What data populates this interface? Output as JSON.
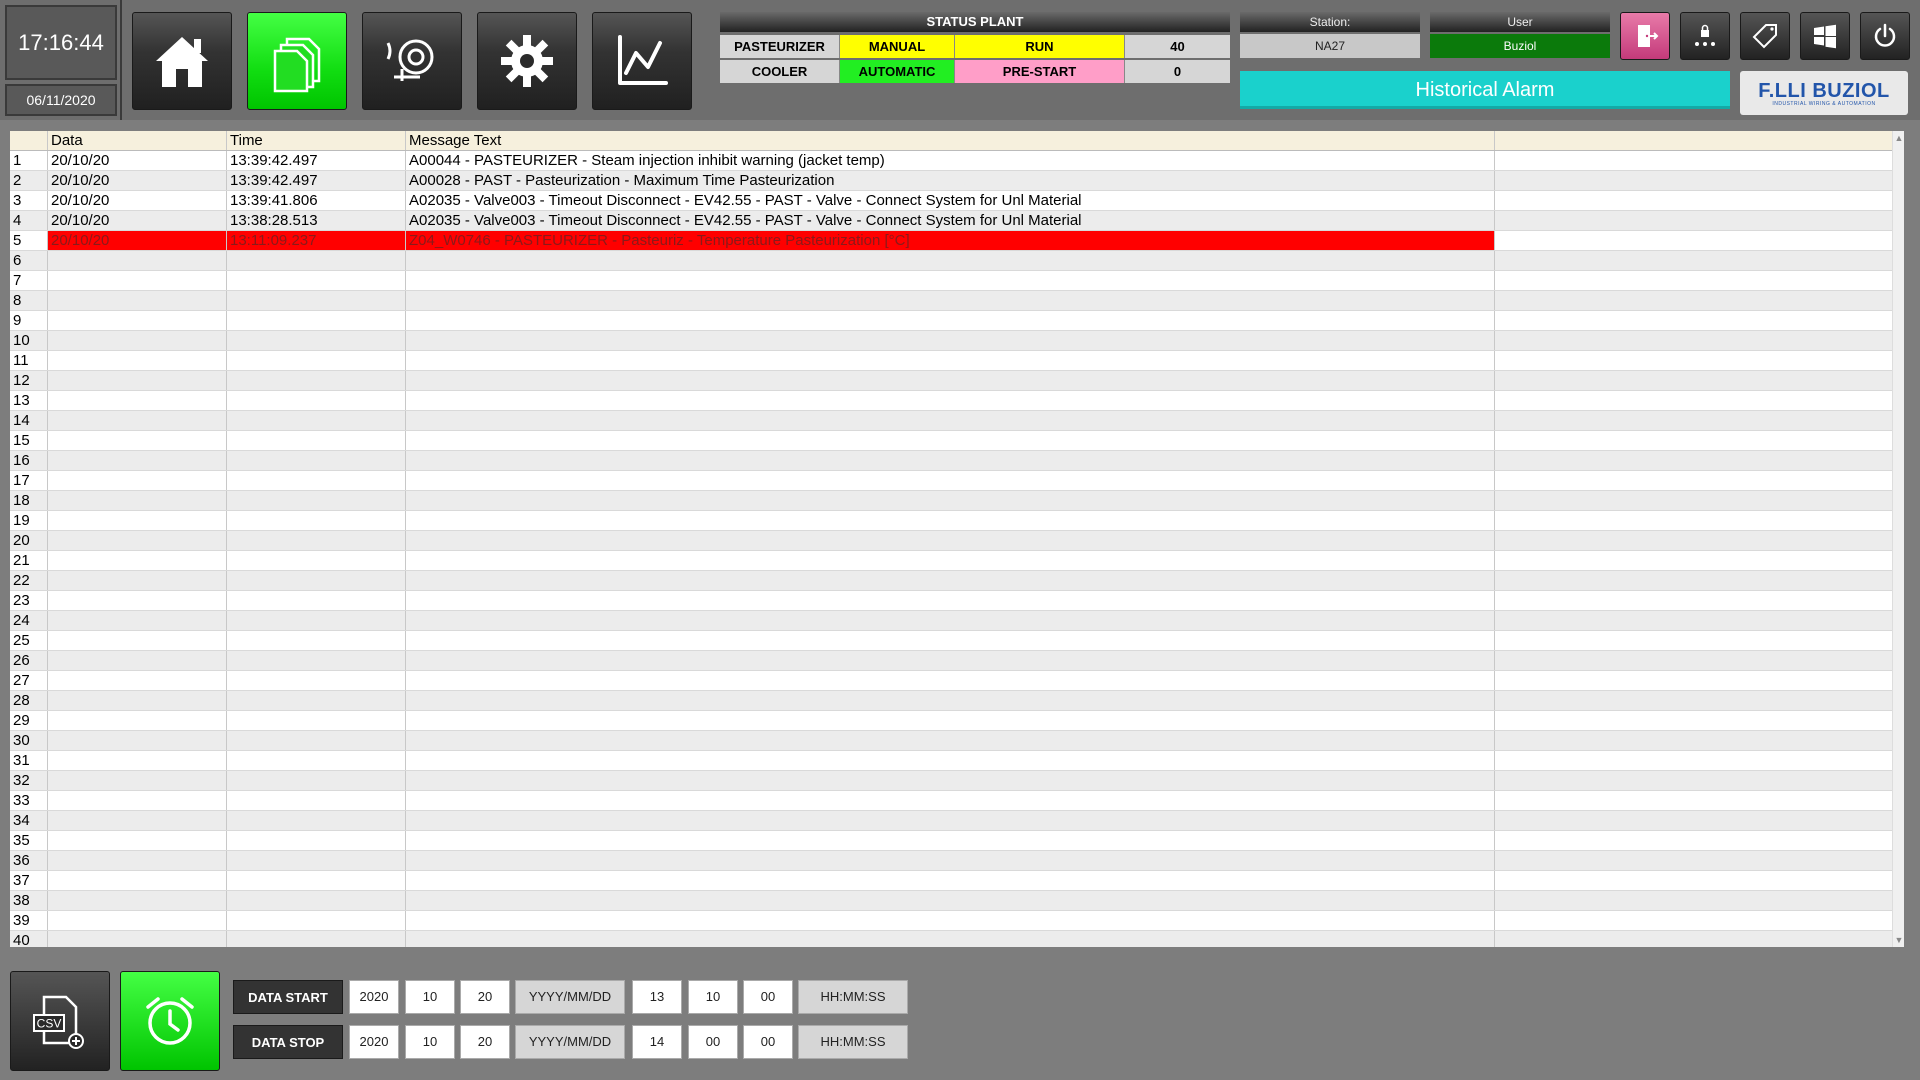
{
  "clock": {
    "time": "17:16:44",
    "date": "06/11/2020"
  },
  "nav": [
    {
      "id": "home",
      "icon": "home-icon",
      "active": false
    },
    {
      "id": "alarms-pages",
      "icon": "documents-icon",
      "active": true
    },
    {
      "id": "bell",
      "icon": "alarm-bell-icon",
      "active": false
    },
    {
      "id": "settings",
      "icon": "gear-icon",
      "active": false
    },
    {
      "id": "trends",
      "icon": "line-chart-icon",
      "active": false
    }
  ],
  "status_plant": {
    "title": "STATUS PLANT",
    "rows": [
      {
        "name": "PASTEURIZER",
        "mode": "MANUAL",
        "state": "RUN",
        "value": "40",
        "mode_color": "#ffff00",
        "state_color": "#ffff00"
      },
      {
        "name": "COOLER",
        "mode": "AUTOMATIC",
        "state": "PRE-START",
        "value": "0",
        "mode_color": "#22ee22",
        "state_color": "#ff9ec8"
      }
    ]
  },
  "station": {
    "label": "Station:",
    "value": "NA27"
  },
  "user": {
    "label": "User",
    "value": "Buziol"
  },
  "page_title": "Historical Alarm",
  "logo": {
    "name": "F.LLI BUZIOL",
    "tagline": "INDUSTRIAL WIRING & AUTOMATION"
  },
  "table": {
    "columns": [
      "",
      "Data",
      "Time",
      "Message Text",
      ""
    ],
    "rows": [
      {
        "n": "1",
        "date": "20/10/20",
        "time": "13:39:42.497",
        "msg": "A00044 - PASTEURIZER - Steam injection inhibit warning (jacket temp)",
        "alarm": false
      },
      {
        "n": "2",
        "date": "20/10/20",
        "time": "13:39:42.497",
        "msg": "A00028 - PAST - Pasteurization - Maximum Time Pasteurization",
        "alarm": false
      },
      {
        "n": "3",
        "date": "20/10/20",
        "time": "13:39:41.806",
        "msg": "A02035 - Valve003 - Timeout Disconnect - EV42.55 - PAST - Valve - Connect System for Unl Material",
        "alarm": false
      },
      {
        "n": "4",
        "date": "20/10/20",
        "time": "13:38:28.513",
        "msg": "A02035 - Valve003 - Timeout Disconnect - EV42.55 - PAST - Valve - Connect System for Unl Material",
        "alarm": false
      },
      {
        "n": "5",
        "date": "20/10/20",
        "time": "13:11:09.237",
        "msg": "Z04_W0746 - PASTEURIZER - Pasteuriz - Temperature Pasteurization [°C]",
        "alarm": true
      },
      {
        "n": "6",
        "date": "",
        "time": "",
        "msg": "",
        "alarm": false
      },
      {
        "n": "7",
        "date": "",
        "time": "",
        "msg": "",
        "alarm": false
      },
      {
        "n": "8",
        "date": "",
        "time": "",
        "msg": "",
        "alarm": false
      },
      {
        "n": "9",
        "date": "",
        "time": "",
        "msg": "",
        "alarm": false
      },
      {
        "n": "10",
        "date": "",
        "time": "",
        "msg": "",
        "alarm": false
      },
      {
        "n": "11",
        "date": "",
        "time": "",
        "msg": "",
        "alarm": false
      },
      {
        "n": "12",
        "date": "",
        "time": "",
        "msg": "",
        "alarm": false
      },
      {
        "n": "13",
        "date": "",
        "time": "",
        "msg": "",
        "alarm": false
      },
      {
        "n": "14",
        "date": "",
        "time": "",
        "msg": "",
        "alarm": false
      },
      {
        "n": "15",
        "date": "",
        "time": "",
        "msg": "",
        "alarm": false
      },
      {
        "n": "16",
        "date": "",
        "time": "",
        "msg": "",
        "alarm": false
      },
      {
        "n": "17",
        "date": "",
        "time": "",
        "msg": "",
        "alarm": false
      },
      {
        "n": "18",
        "date": "",
        "time": "",
        "msg": "",
        "alarm": false
      },
      {
        "n": "19",
        "date": "",
        "time": "",
        "msg": "",
        "alarm": false
      },
      {
        "n": "20",
        "date": "",
        "time": "",
        "msg": "",
        "alarm": false
      },
      {
        "n": "21",
        "date": "",
        "time": "",
        "msg": "",
        "alarm": false
      },
      {
        "n": "22",
        "date": "",
        "time": "",
        "msg": "",
        "alarm": false
      },
      {
        "n": "23",
        "date": "",
        "time": "",
        "msg": "",
        "alarm": false
      },
      {
        "n": "24",
        "date": "",
        "time": "",
        "msg": "",
        "alarm": false
      },
      {
        "n": "25",
        "date": "",
        "time": "",
        "msg": "",
        "alarm": false
      },
      {
        "n": "26",
        "date": "",
        "time": "",
        "msg": "",
        "alarm": false
      },
      {
        "n": "27",
        "date": "",
        "time": "",
        "msg": "",
        "alarm": false
      },
      {
        "n": "28",
        "date": "",
        "time": "",
        "msg": "",
        "alarm": false
      },
      {
        "n": "29",
        "date": "",
        "time": "",
        "msg": "",
        "alarm": false
      },
      {
        "n": "30",
        "date": "",
        "time": "",
        "msg": "",
        "alarm": false
      },
      {
        "n": "31",
        "date": "",
        "time": "",
        "msg": "",
        "alarm": false
      },
      {
        "n": "32",
        "date": "",
        "time": "",
        "msg": "",
        "alarm": false
      },
      {
        "n": "33",
        "date": "",
        "time": "",
        "msg": "",
        "alarm": false
      },
      {
        "n": "34",
        "date": "",
        "time": "",
        "msg": "",
        "alarm": false
      },
      {
        "n": "35",
        "date": "",
        "time": "",
        "msg": "",
        "alarm": false
      },
      {
        "n": "36",
        "date": "",
        "time": "",
        "msg": "",
        "alarm": false
      },
      {
        "n": "37",
        "date": "",
        "time": "",
        "msg": "",
        "alarm": false
      },
      {
        "n": "38",
        "date": "",
        "time": "",
        "msg": "",
        "alarm": false
      },
      {
        "n": "39",
        "date": "",
        "time": "",
        "msg": "",
        "alarm": false
      },
      {
        "n": "40",
        "date": "",
        "time": "",
        "msg": "",
        "alarm": false
      }
    ]
  },
  "bottom": {
    "csv_label": "CSV",
    "data_start": {
      "label": "DATA START",
      "year": "2020",
      "month": "10",
      "day": "20",
      "date_format": "YYYY/MM/DD",
      "hour": "13",
      "minute": "10",
      "second": "00",
      "time_format": "HH:MM:SS"
    },
    "data_stop": {
      "label": "DATA STOP",
      "year": "2020",
      "month": "10",
      "day": "20",
      "date_format": "YYYY/MM/DD",
      "hour": "14",
      "minute": "00",
      "second": "00",
      "time_format": "HH:MM:SS"
    }
  }
}
